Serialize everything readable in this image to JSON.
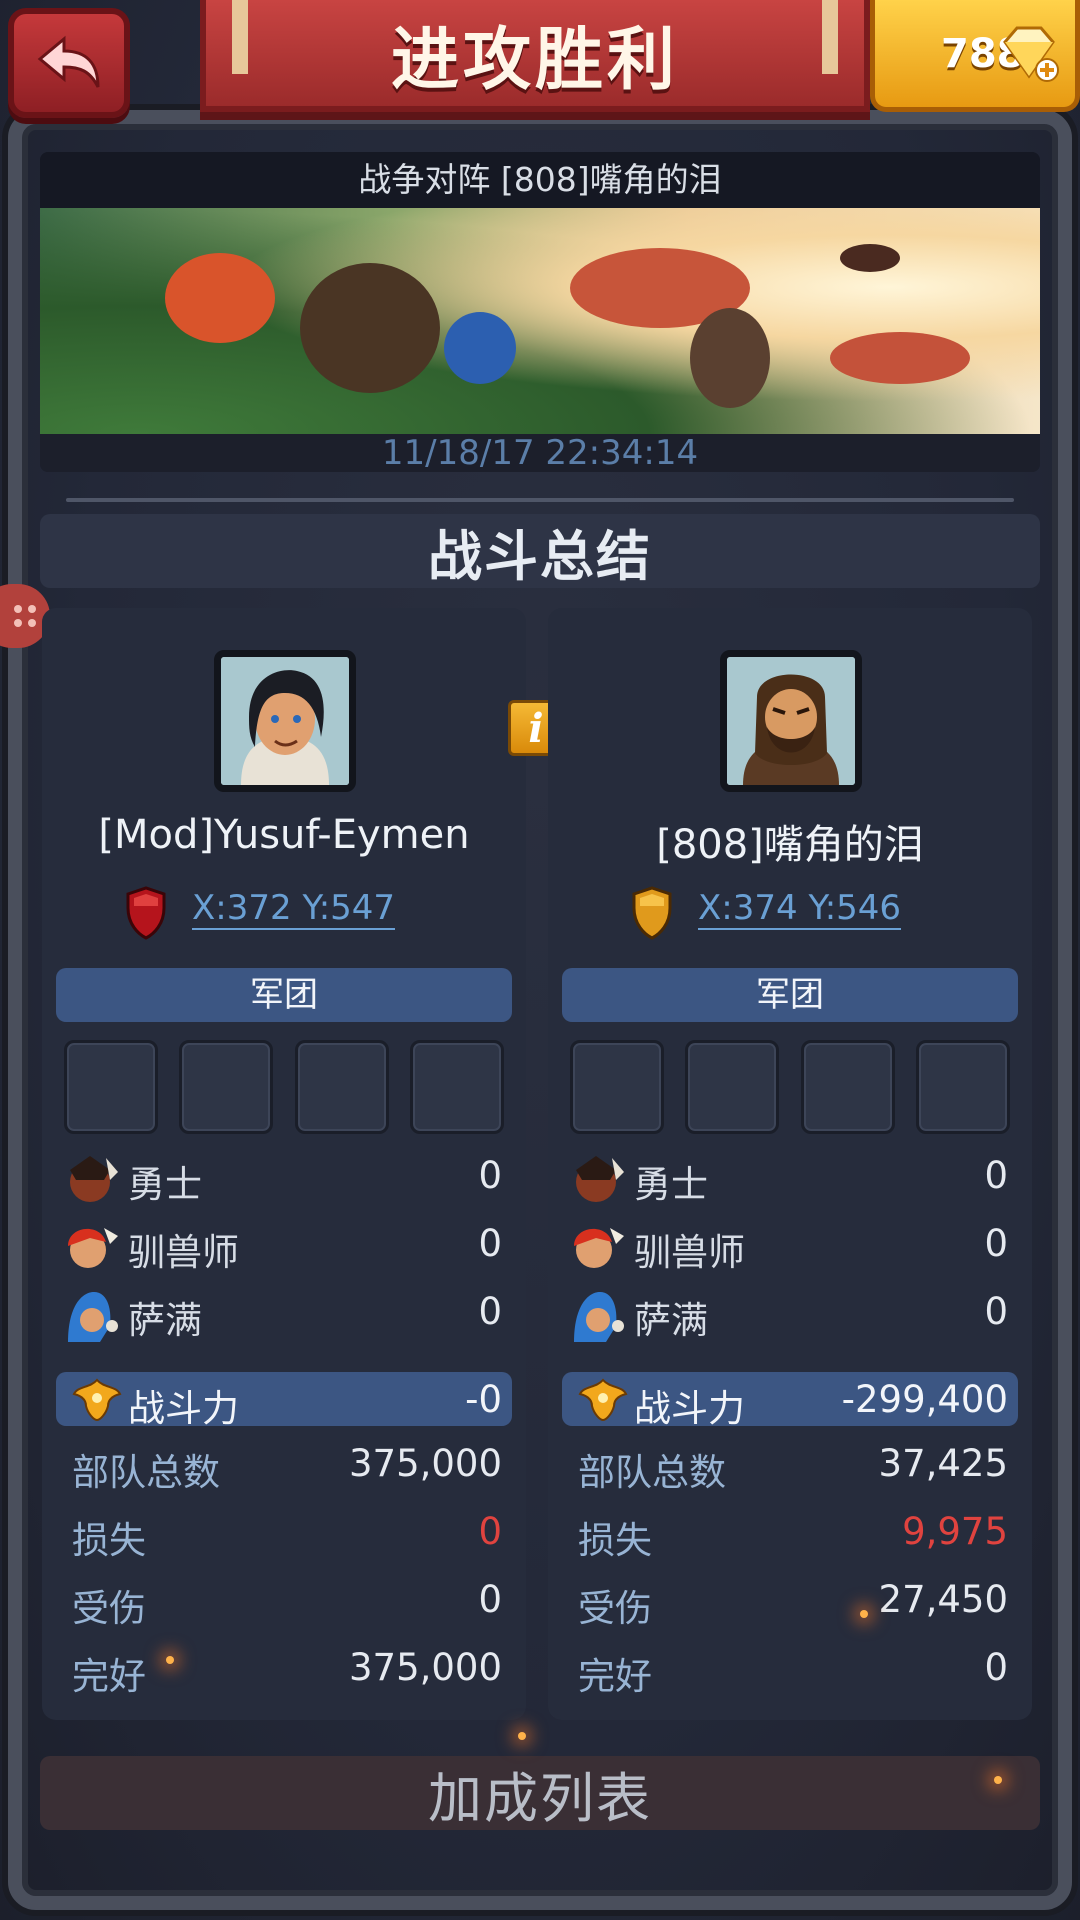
{
  "header": {
    "title": "进攻胜利",
    "gems": "788"
  },
  "battle": {
    "title": "战争对阵 [808]嘴角的泪",
    "date": "11/18/17 22:34:14"
  },
  "summary_title": "战斗总结",
  "bonus_title": "加成列表",
  "attacker": {
    "name": "[Mod]Yusuf-Eymen",
    "coords": "X:372 Y:547",
    "legion_label": "军团",
    "units": [
      {
        "label": "勇士",
        "value": "0"
      },
      {
        "label": "驯兽师",
        "value": "0"
      },
      {
        "label": "萨满",
        "value": "0"
      }
    ],
    "power_label": "战斗力",
    "power_value": "-0",
    "stats": [
      {
        "label": "部队总数",
        "value": "375,000"
      },
      {
        "label": "损失",
        "value": "0"
      },
      {
        "label": "受伤",
        "value": "0"
      },
      {
        "label": "完好",
        "value": "375,000"
      }
    ]
  },
  "defender": {
    "name": "[808]嘴角的泪",
    "coords": "X:374 Y:546",
    "legion_label": "军团",
    "units": [
      {
        "label": "勇士",
        "value": "0"
      },
      {
        "label": "驯兽师",
        "value": "0"
      },
      {
        "label": "萨满",
        "value": "0"
      }
    ],
    "power_label": "战斗力",
    "power_value": "-299,400",
    "stats": [
      {
        "label": "部队总数",
        "value": "37,425"
      },
      {
        "label": "损失",
        "value": "9,975"
      },
      {
        "label": "受伤",
        "value": "27,450"
      },
      {
        "label": "完好",
        "value": "0"
      }
    ]
  },
  "colors": {
    "loss": "#e0433f",
    "link": "#6aa0d4",
    "bar": "#3c5683",
    "attacker_shield": "#b5141c",
    "defender_shield": "#e09a1c"
  },
  "icons": {
    "back": "back-arrow-icon",
    "gem": "gem-plus-icon",
    "info": "info-icon",
    "power": "phoenix-icon"
  }
}
